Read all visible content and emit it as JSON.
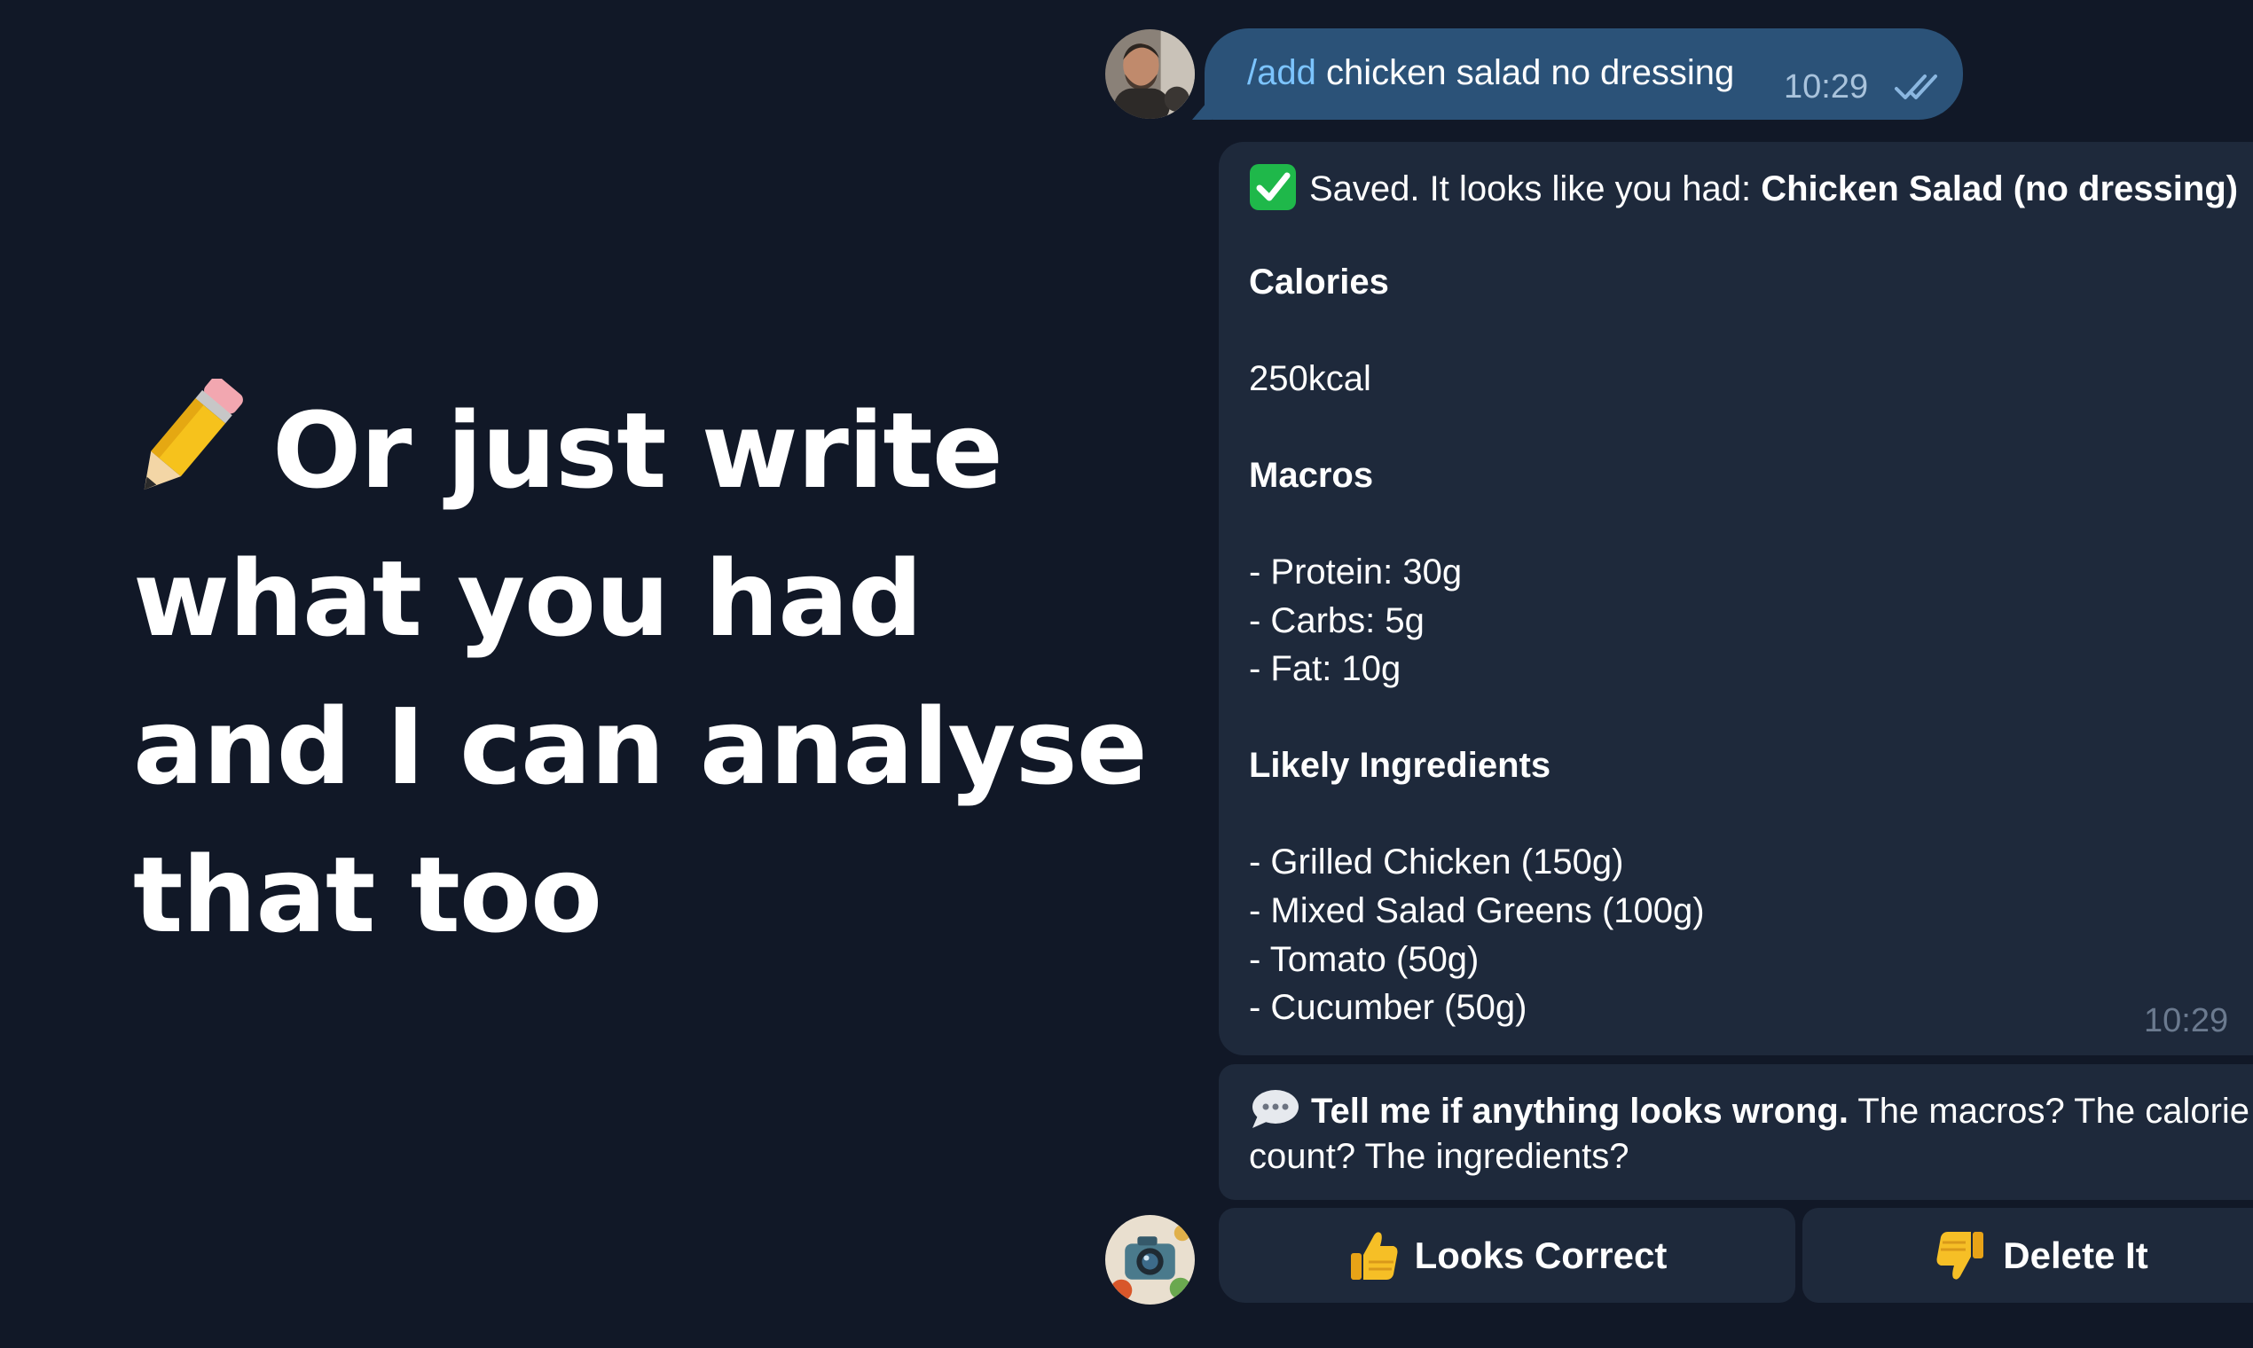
{
  "headline": {
    "icon": "pencil-icon",
    "lines": [
      "Or just write",
      "what you had",
      "and I can analyse",
      "that too"
    ]
  },
  "outgoing": {
    "command": "/add",
    "text": " chicken salad no dressing",
    "time": "10:29",
    "status_icon": "double-check-icon"
  },
  "reply": {
    "saved_prefix": "Saved. It looks like you had: ",
    "dish": "Chicken Salad (no dressing)",
    "calories_heading": "Calories",
    "calories_value": "250kcal",
    "macros_heading": "Macros",
    "macros": [
      "- Protein: 30g",
      "- Carbs: 5g",
      "- Fat: 10g"
    ],
    "ingredients_heading": "Likely Ingredients",
    "ingredients": [
      "- Grilled Chicken (150g)",
      "- Mixed Salad Greens (100g)",
      "- Tomato (50g)",
      "- Cucumber (50g)"
    ],
    "time": "10:29"
  },
  "feedback": {
    "bold": "Tell me if anything looks wrong.",
    "rest": " The macros? The calorie",
    "line2": "count? The ingredients?"
  },
  "buttons": {
    "correct": "Looks Correct",
    "delete": "Delete It"
  },
  "colors": {
    "background": "#111827",
    "outgoing_bubble": "#2b5278",
    "incoming_bubble": "#1e293b",
    "command_link": "#7cc4ff"
  }
}
